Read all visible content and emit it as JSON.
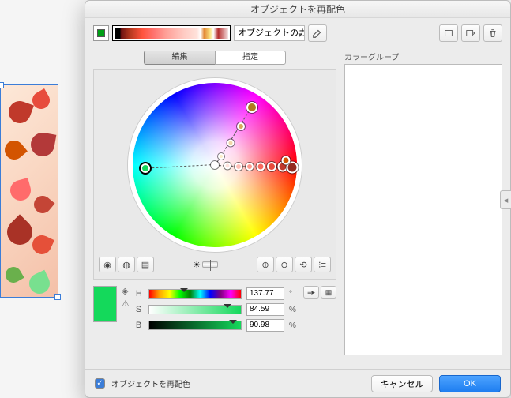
{
  "dialog": {
    "title": "オブジェクトを再配色",
    "preset_select": "オブジェクトのカラー",
    "tabs": {
      "edit": "編集",
      "assign": "指定"
    },
    "rightpanel_label": "カラーグループ"
  },
  "hsb": {
    "h_label": "H",
    "s_label": "S",
    "b_label": "B",
    "h_value": "137.77",
    "s_value": "84.59",
    "b_value": "90.98",
    "h_unit": "°",
    "s_unit": "%",
    "b_unit": "%",
    "preview_color": "#14d95b"
  },
  "footer": {
    "checkbox_label": "オブジェクトを再配色",
    "cancel": "キャンセル",
    "ok": "OK"
  }
}
